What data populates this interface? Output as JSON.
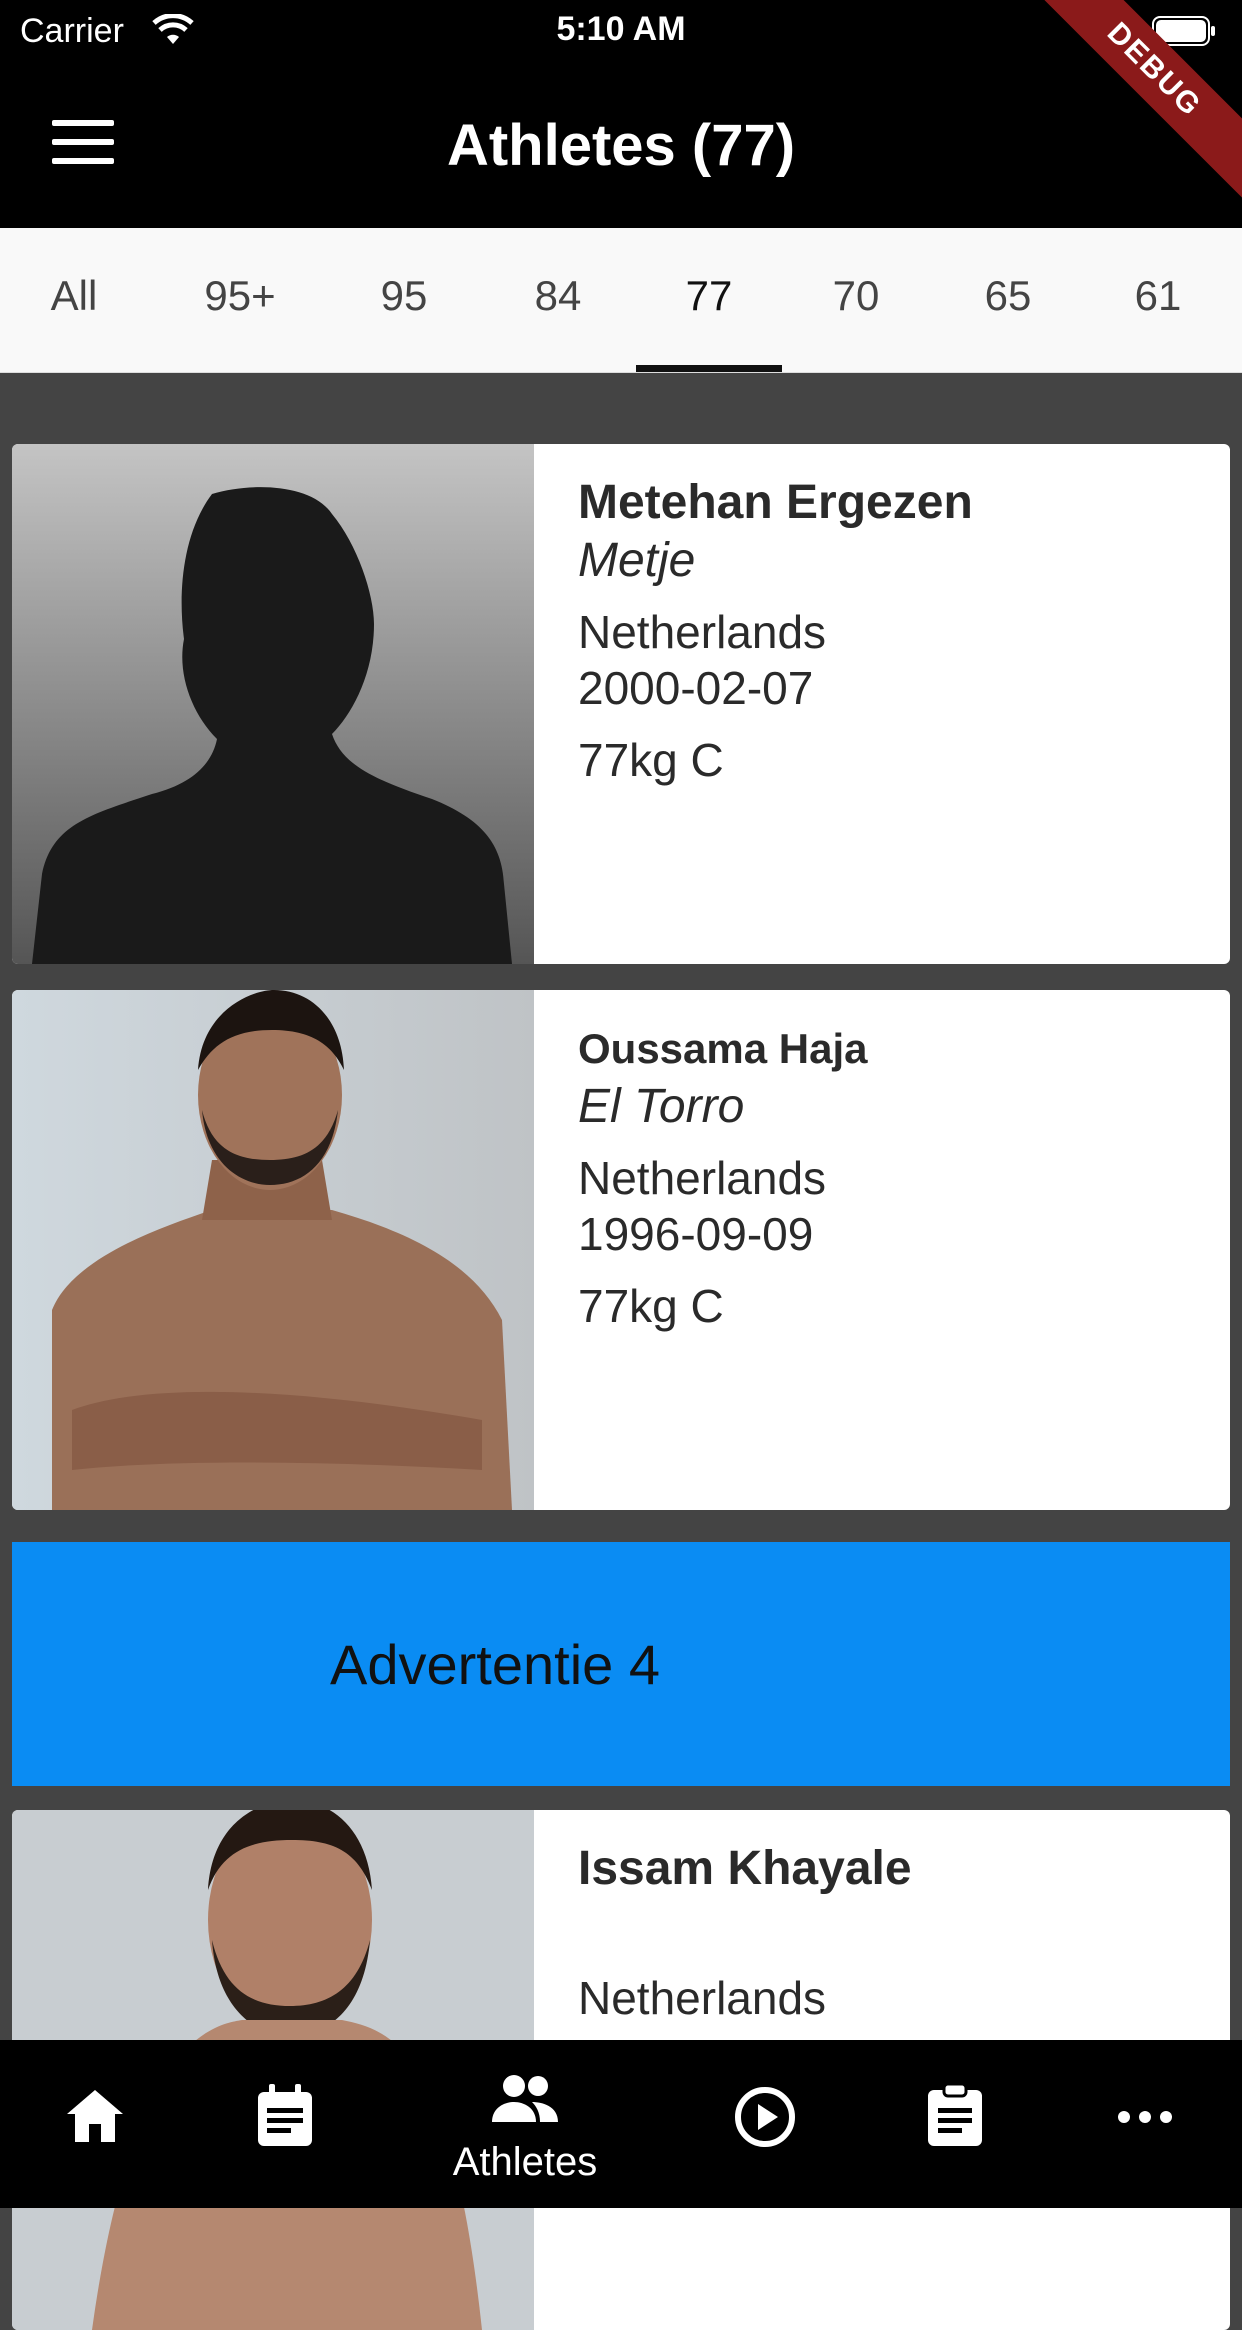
{
  "status_bar": {
    "carrier": "Carrier",
    "time": "5:10 AM"
  },
  "app_bar": {
    "title": "Athletes (77)",
    "debug_banner": "DEBUG"
  },
  "tabs": [
    {
      "label": "All"
    },
    {
      "label": "95+"
    },
    {
      "label": "95"
    },
    {
      "label": "84"
    },
    {
      "label": "77",
      "active": true
    },
    {
      "label": "70"
    },
    {
      "label": "65"
    },
    {
      "label": "61"
    }
  ],
  "athletes": [
    {
      "name": "Metehan Ergezen",
      "nickname": "Metje",
      "country": "Netherlands",
      "dob": "2000-02-07",
      "weight_class": "77kg  C",
      "photo": "silhouette-placeholder"
    },
    {
      "name": "Oussama Haja",
      "nickname": "El Torro",
      "country": "Netherlands",
      "dob": "1996-09-09",
      "weight_class": "77kg  C",
      "photo": "athlete-photo"
    },
    {
      "name": "Issam Khayale",
      "nickname": "",
      "country": "Netherlands",
      "photo": "athlete-photo"
    }
  ],
  "ad": {
    "label": "Advertentie 4",
    "color": "#0a8cf3"
  },
  "bottom_nav": [
    {
      "icon": "home-icon"
    },
    {
      "icon": "calendar-news-icon"
    },
    {
      "icon": "people-icon",
      "label": "Athletes",
      "active": true
    },
    {
      "icon": "play-circle-icon"
    },
    {
      "icon": "clipboard-icon"
    },
    {
      "icon": "more-icon"
    }
  ]
}
